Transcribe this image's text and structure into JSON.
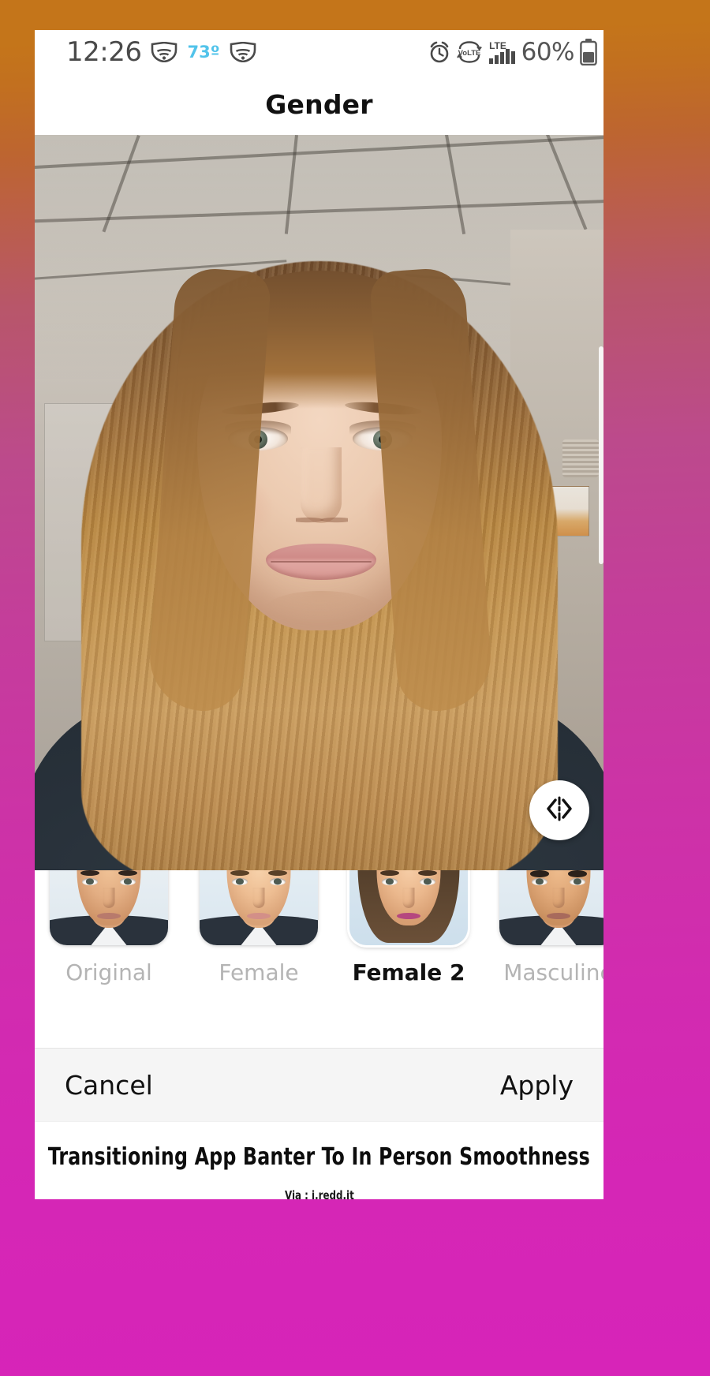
{
  "frame": {
    "gradient_top": "#c4751a",
    "gradient_bottom": "#d724b8"
  },
  "status_bar": {
    "time": "12:26",
    "temperature": "73º",
    "battery_percent": "60%",
    "icons": [
      "wifi-shield-icon",
      "wifi-shield-icon",
      "alarm-icon",
      "volte-icon",
      "lte-signal-icon",
      "battery-icon"
    ],
    "lte_label": "LTE",
    "volte_label": "VoLTE"
  },
  "header": {
    "title": "Gender"
  },
  "photo": {
    "alt": "portrait-preview",
    "compare_icon": "compare-split-icon"
  },
  "styles": {
    "selected_index": 2,
    "items": [
      {
        "label": "Original",
        "selected": false
      },
      {
        "label": "Female",
        "selected": false
      },
      {
        "label": "Female 2",
        "selected": true
      },
      {
        "label": "Masculine",
        "selected": false
      }
    ]
  },
  "actions": {
    "cancel_label": "Cancel",
    "apply_label": "Apply"
  },
  "caption": {
    "headline": "Transitioning App Banter To In Person Smoothness",
    "source": "Via : i.redd.it"
  }
}
